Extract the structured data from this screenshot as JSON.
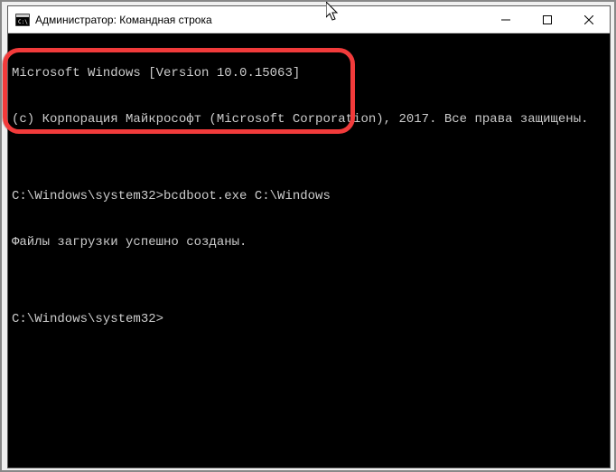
{
  "window": {
    "title": "Администратор: Командная строка"
  },
  "terminal": {
    "lines": [
      "Microsoft Windows [Version 10.0.15063]",
      "(c) Корпорация Майкрософт (Microsoft Corporation), 2017. Все права защищены.",
      "",
      "C:\\Windows\\system32>bcdboot.exe C:\\Windows",
      "Файлы загрузки успешно созданы.",
      "",
      "C:\\Windows\\system32>"
    ]
  }
}
